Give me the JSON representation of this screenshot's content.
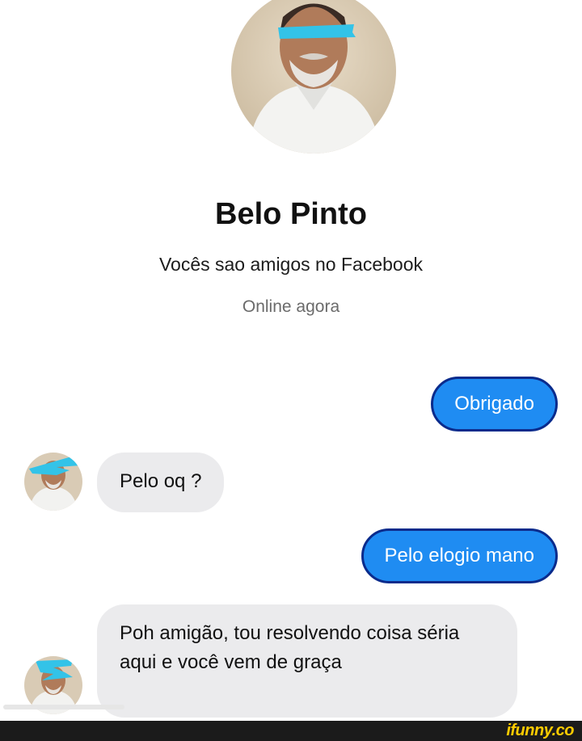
{
  "contact": {
    "name": "Belo Pinto",
    "friendship": "Vocês sao amigos no Facebook",
    "status": "Online agora"
  },
  "messages": [
    {
      "from": "me",
      "text": "Obrigado"
    },
    {
      "from": "contact",
      "text": "Pelo oq ?"
    },
    {
      "from": "me",
      "text": "Pelo elogio mano"
    },
    {
      "from": "contact",
      "text": "Poh amigão, tou resolvendo coisa séria aqui e você vem de graça"
    }
  ],
  "watermark": {
    "brand": "ifunny.co"
  },
  "colors": {
    "sent_bubble": "#1f8cf2",
    "received_bubble": "#ebebed",
    "censor_mark": "#33c3e8"
  }
}
